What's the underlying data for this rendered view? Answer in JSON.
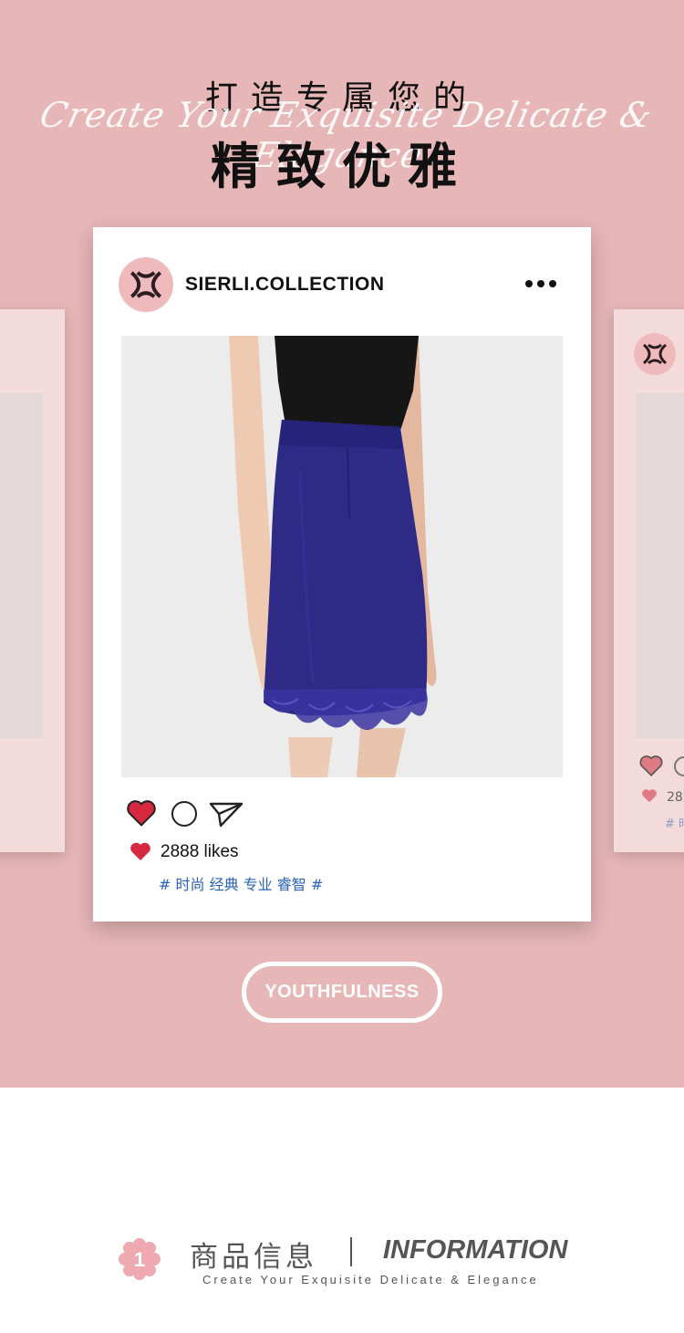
{
  "header": {
    "title_top": "打造专属您的",
    "script_text": "Create Your Exquisite Delicate & Elegance",
    "title_main": "精致优雅"
  },
  "post": {
    "account_name": "SIERLI.COLLECTION",
    "likes_text": "2888 likes",
    "hashtags": "# 时尚 经典 专业 睿智 #",
    "icons": [
      "logo-icon",
      "more-icon",
      "heart-icon",
      "comment-icon",
      "send-icon"
    ]
  },
  "ghost_right": {
    "likes_text": "28",
    "tag_text": "# 时"
  },
  "badge": {
    "label": "YOUTHFULNESS"
  },
  "info": {
    "number": "1",
    "title_cn": "商品信息",
    "title_en": "INFORMATION",
    "subtitle": "Create Your Exquisite Delicate & Elegance"
  },
  "colors": {
    "background_pink": "#e7b6b7",
    "card_pink": "#f3dadb",
    "avatar_pink": "#f0b9bc",
    "heart_red": "#d6283f",
    "hashtag_blue": "#2b62b5",
    "skirt_navy": "#2e2a86"
  }
}
